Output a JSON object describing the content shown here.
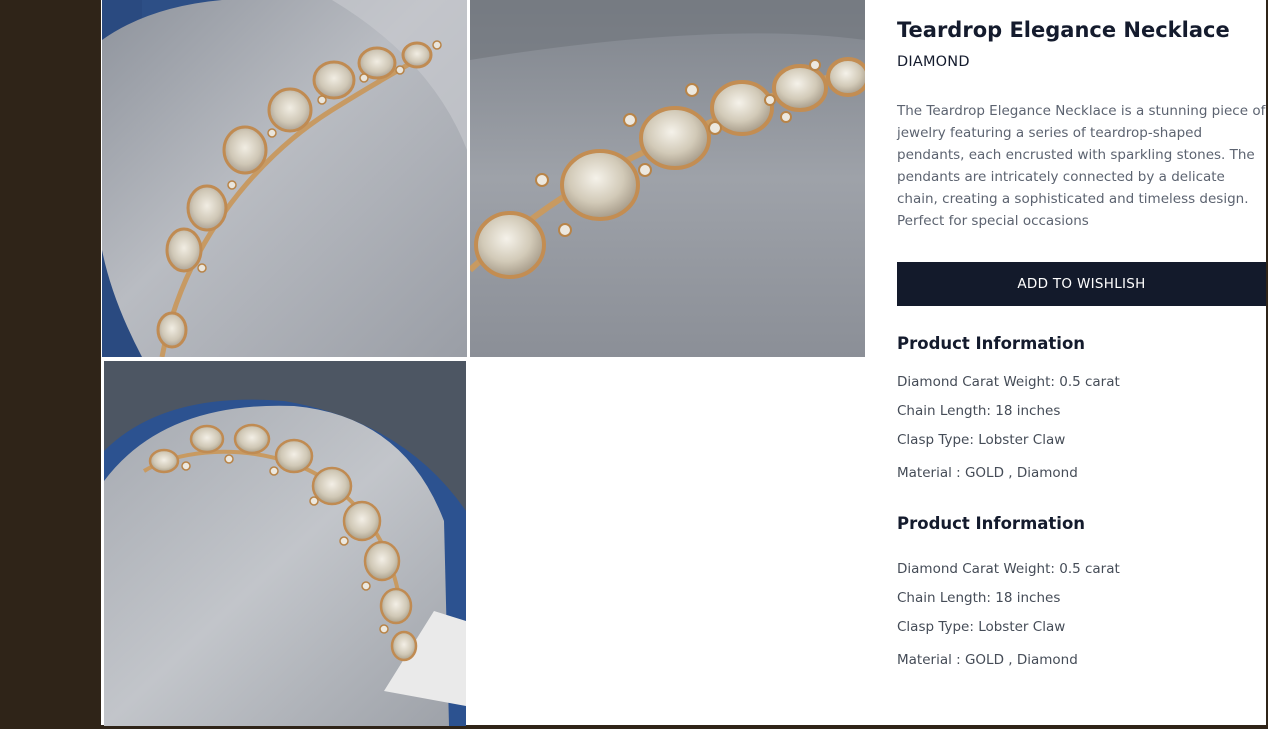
{
  "product": {
    "title": "Teardrop Elegance Necklace",
    "category": "DIAMOND",
    "description": "The Teardrop Elegance Necklace is a stunning piece of jewelry featuring a series of teardrop-shaped pendants, each encrusted with sparkling stones. The pendants are intricately connected by a delicate chain, creating a sophisticated and timeless design. Perfect for special occasions",
    "wishlist_label": "ADD TO WISHLISH"
  },
  "info_sections": [
    {
      "heading": "Product Information",
      "lines": [
        "Diamond Carat Weight: 0.5 carat",
        "Chain Length: 18 inches",
        "Clasp Type: Lobster Claw",
        "Material : GOLD , Diamond"
      ]
    },
    {
      "heading": "Product Information",
      "lines": [
        "Diamond Carat Weight: 0.5 carat",
        "Chain Length: 18 inches",
        "Clasp Type: Lobster Claw",
        "Material : GOLD , Diamond"
      ]
    }
  ],
  "colors": {
    "page_background": "#2f2418",
    "button_background": "#131a2b",
    "heading_text": "#141b2d",
    "body_text": "#5c6370"
  }
}
